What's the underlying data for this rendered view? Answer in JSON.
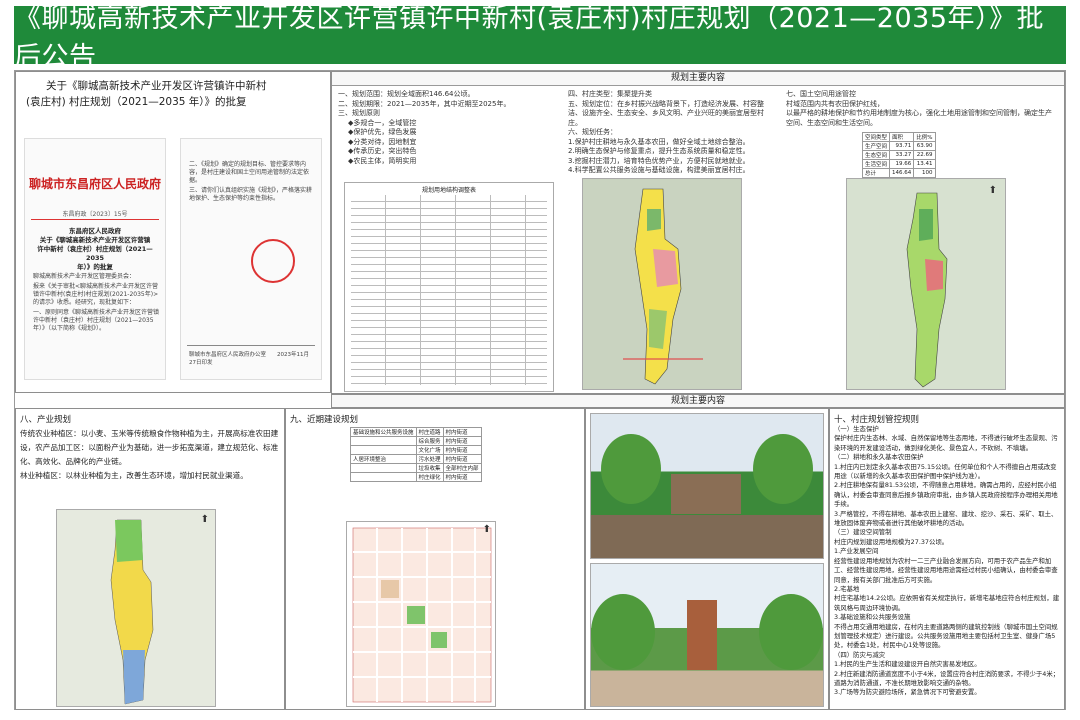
{
  "page_title": "《聊城高新技术产业开发区许营镇许中新村(袁庄村)村庄规划（2021—2035年）》批后公告",
  "approval": {
    "heading_line1": "关于《聊城高新技术产业开发区许营镇许中新村",
    "heading_line2": "(袁庄村) 村庄规划（2021—2035 年）》的批复",
    "gov_header": "聊城市东昌府区人民政府",
    "doc_number": "东昌府政〔2023〕15号",
    "doc_title_line1": "东昌府区人民政府",
    "doc_title_line2": "关于《聊城高新技术产业开发区许营镇",
    "doc_title_line3": "许中新村（袁庄村）村庄规划（2021—2035",
    "doc_title_line4": "年）》的批复",
    "doc_body_1": "聊城高新技术产业开发区管理委员会：",
    "doc_body_2": "报来《关于审批<聊城高新技术产业开发区许营镇许中新村(袁庄村)村庄规划(2021-2035年)>的请示》收悉。经研究，现批复如下：",
    "doc_body_3": "一、原则同意《聊城高新技术产业开发区许营镇许中新村（袁庄村）村庄规划（2021—2035年）》（以下简称《规划》）。",
    "right_body_1": "二、《规划》确定的规划目标、管控要求等内容，是村庄建设和国土空间用途管制的法定依据。",
    "right_body_2": "三、请你们认真组织实施《规划》，严格落实耕地保护、生态保护等约束性指标。",
    "right_footer": "聊城市东昌府区人民政府办公室　　2023年11月27日印发"
  },
  "main_content": {
    "header": "规划主要内容",
    "col1": [
      "一、规划范围：规划全域面积146.64公顷。",
      "二、规划期限：2021—2035年，其中近期至2025年。",
      "三、规划原则",
      "◆多规合一，全域管控",
      "◆保护优先，绿色发展",
      "◆分类对待，因地制宜",
      "◆传承历史，突出特色",
      "◆农民主体，简明实用"
    ],
    "col2": [
      "四、村庄类型：集聚提升类",
      "五、规划定位：在乡村振兴战略背景下，打造经济发展、村容整洁、设施齐全、生态安全、乡风文明、产业兴旺的美丽宜居型村庄。",
      "六、规划任务：",
      "1.保护村庄耕地与永久基本农田，做好全域土地综合整治。",
      "2.明确生态保护与修复重点，提升生态系统质量和稳定性。",
      "3.挖掘村庄潜力，培育特色优势产业，方便村民就地就业。",
      "4.科学配置公共服务设施与基础设施，构建美丽宜居村庄。"
    ],
    "col3": [
      "七、国土空间用途管控",
      "村域范围内共有农田保护红线，",
      "以最严格的耕地保护和节约用地制度为核心，强化土地用途管制和空间管制，确定生产空间、生态空间和生活空间。"
    ],
    "space_table": {
      "headers": [
        "空间类型",
        "面积",
        "比例%"
      ],
      "rows": [
        [
          "生产空间",
          "93.71",
          "63.90"
        ],
        [
          "生态空间",
          "33.27",
          "22.69"
        ],
        [
          "生活空间",
          "19.66",
          "13.41"
        ],
        [
          "总计",
          "146.64",
          "100"
        ]
      ]
    },
    "small_table_title": "规划用地结构调整表"
  },
  "planning_header": "规划主要内容",
  "section8": {
    "label": "八、产业规划",
    "para1": "传统农业种植区：以小麦、玉米等传统粮食作物种植为主，开展高标准农田建设，农产品加工区：以面粉产业为基础，进一步拓宽渠道，建立规范化、标准化、高效化、品牌化的产业链。",
    "para2": "林业种植区：以林业种植为主，改善生态环境，增加村民就业渠道。"
  },
  "section9": {
    "label": "九、近期建设规划",
    "table_rows": [
      [
        "基础设施和公共服务设施",
        "村庄道路",
        "村内街道"
      ],
      [
        "",
        "综合服务",
        "村内街道"
      ],
      [
        "",
        "文化广场",
        "村内街道"
      ],
      [
        "人居环境整治",
        "污水处理",
        "村内街道"
      ],
      [
        "",
        "垃圾收集",
        "全部村庄内部"
      ],
      [
        "",
        "村庄绿化",
        "村内街道"
      ]
    ]
  },
  "section10": {
    "label": "十、村庄规划管控规则",
    "lines": [
      "（一）生态保护",
      "保护村庄内生态林、水域、自然保留地等生态用地，不得进行破坏生态景观、污染环境的开发建设活动，做到绿化美化、景色宜人，不砍树、不填塘。",
      "（二）耕地和永久基本农田保护",
      "1.村庄内已划定永久基本农田75.15公顷。任何单位和个人不得擅自占用或改变用途（以新增的永久基本农田保护图中保护线为准）。",
      "2.村庄耕地保有量81.53公顷，不得随意占用耕地，确需占用的，应经村民小组确认，村委会审查同意后报乡镇政府审批，由乡镇人民政府按程序办理相关用地手续。",
      "3.严格管控，不得在耕地、基本农田上建窑、建坟、挖沙、采石、采矿、取土、堆放固体废弃物或者进行其他破坏耕地的活动。",
      "（三）建设空间管制",
      "村庄内规划建设用地规模为27.37公顷。",
      "1.产业发展空间",
      "经营性建设用地规划为农村一二三产业融合发展方向，可用于农产品生产和加工、经营性建设用地，经营性建设用地用途需经过村民小组确认，由村委会审查同意，报有关部门批准后方可实施。",
      "2.宅基地",
      "村庄宅基地14.2公顷。应依照省有关规定执行，新增宅基地应符合村庄规划，建筑风格与周边环境协调。",
      "3.基础设施和公共服务设施",
      "不得占用交通用地建房，在村内主要道路两侧的建筑控制线（聊城市国土空间规划管理技术规定）进行建设。公共服务设施用地主要包括村卫生室、健身广场5处，村委会1处，村民中心1处等设施。",
      "（四）防灾与减灾",
      "1.村民的生产生活和建设建设开自然灾害易发地区。",
      "2.村庄新建消防通道宽度不小于4米，设置应符合村庄消防要求，不得少于4米；道路为消防通道，不准长期堆放影响交通的杂物。",
      "3.广场等为防灾避险场所，紧急情况下可警避安置。"
    ]
  }
}
